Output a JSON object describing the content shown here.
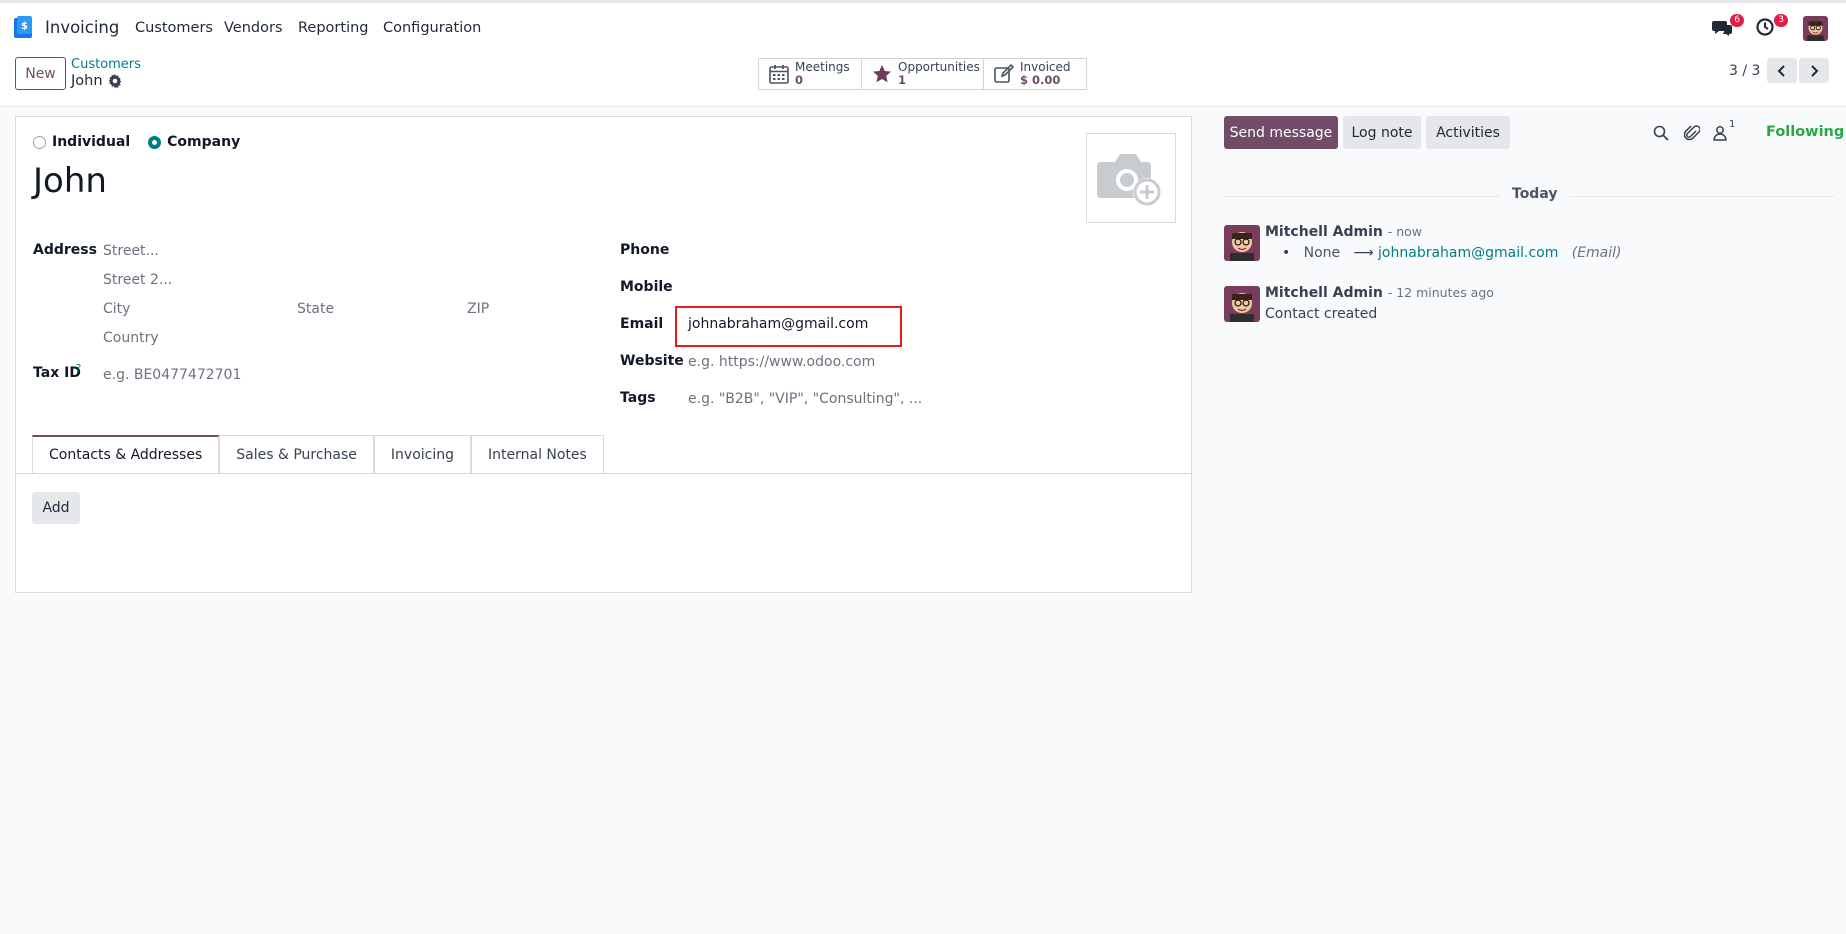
{
  "topbar": {
    "app_name": "Invoicing",
    "menu": [
      "Customers",
      "Vendors",
      "Reporting",
      "Configuration"
    ],
    "messages_count": "6",
    "activities_count": "3"
  },
  "control": {
    "new_label": "New",
    "breadcrumb_parent": "Customers",
    "breadcrumb_current": "John",
    "smart_buttons": [
      {
        "label": "Meetings",
        "value": "0",
        "icon": "calendar-icon"
      },
      {
        "label": "Opportunities",
        "value": "1",
        "icon": "star-icon"
      },
      {
        "label": "Invoiced",
        "value": "$ 0.00",
        "icon": "edit-icon"
      }
    ],
    "pager": "3 / 3"
  },
  "form": {
    "type_individual": "Individual",
    "type_company": "Company",
    "selected_type": "Company",
    "name": "John",
    "address_label": "Address",
    "street_ph": "Street...",
    "street2_ph": "Street 2...",
    "city_ph": "City",
    "state_ph": "State",
    "zip_ph": "ZIP",
    "country_ph": "Country",
    "taxid_label": "Tax ID",
    "taxid_help": "?",
    "taxid_ph": "e.g. BE0477472701",
    "phone_label": "Phone",
    "mobile_label": "Mobile",
    "email_label": "Email",
    "email_value": "johnabraham@gmail.com",
    "website_label": "Website",
    "website_ph": "e.g. https://www.odoo.com",
    "tags_label": "Tags",
    "tags_ph": "e.g. \"B2B\", \"VIP\", \"Consulting\", ...",
    "tabs": [
      "Contacts & Addresses",
      "Sales & Purchase",
      "Invoicing",
      "Internal Notes"
    ],
    "add_label": "Add"
  },
  "chatter": {
    "send_message": "Send message",
    "log_note": "Log note",
    "activities": "Activities",
    "followers_count": "1",
    "following": "Following",
    "today": "Today",
    "messages": [
      {
        "author": "Mitchell Admin",
        "time": "- now",
        "old": "None",
        "arrow": "⟶",
        "new": "johnabraham@gmail.com",
        "field": "(Email)"
      },
      {
        "author": "Mitchell Admin",
        "time": "- 12 minutes ago",
        "body": "Contact created"
      }
    ]
  },
  "colors": {
    "brand": "#714b67",
    "link": "#017e84",
    "following": "#28a745",
    "highlight": "#e11d1d"
  }
}
